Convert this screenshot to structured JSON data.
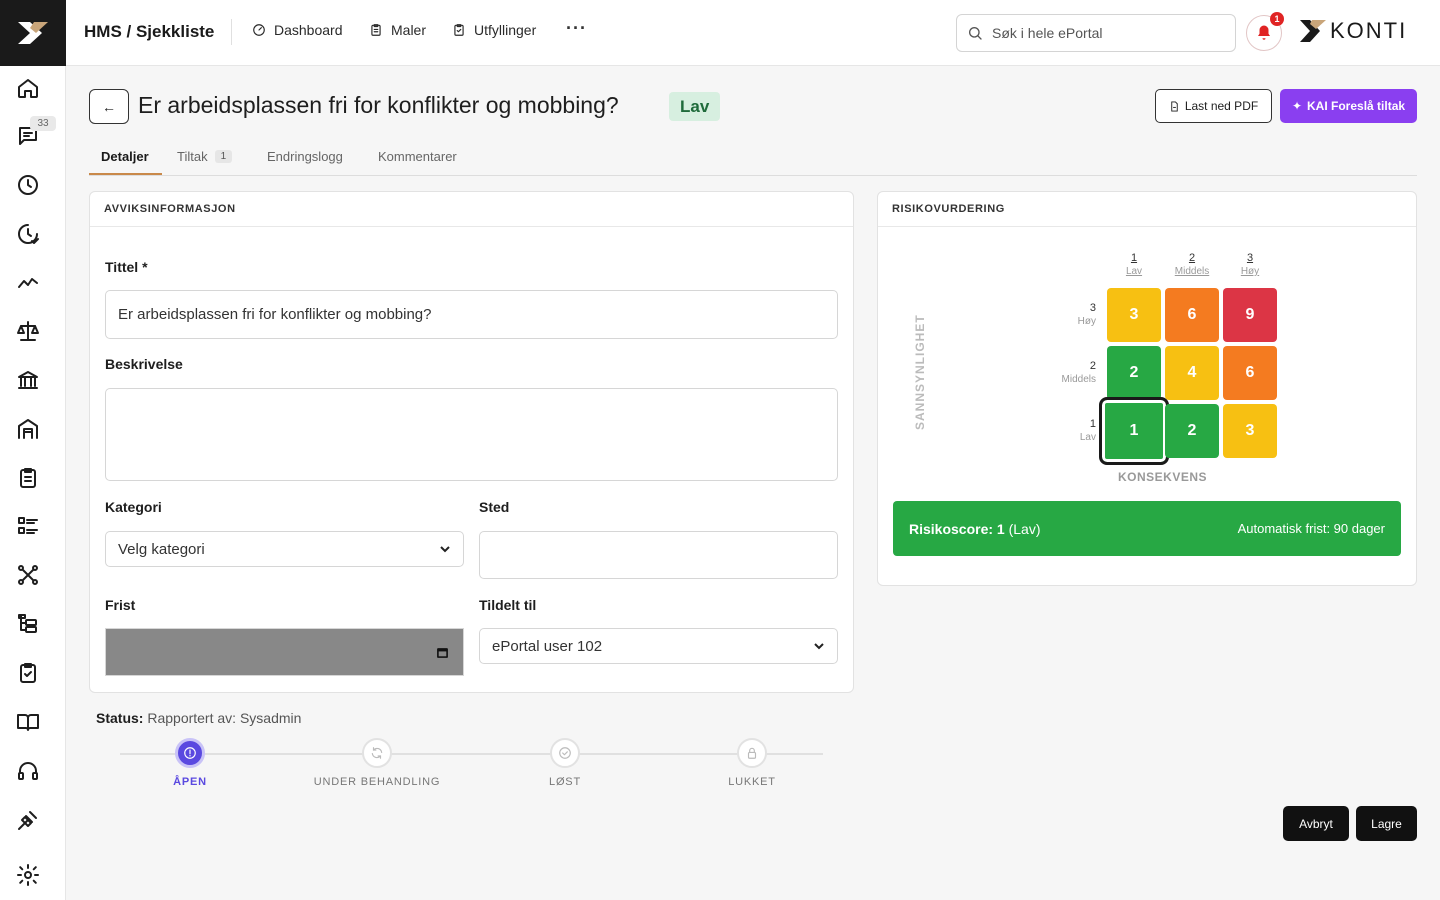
{
  "app": {
    "breadcrumb": "HMS / Sjekkliste",
    "nav": [
      {
        "label": "Dashboard",
        "icon": "dashboard-icon"
      },
      {
        "label": "Maler",
        "icon": "clipboard-icon"
      },
      {
        "label": "Utfyllinger",
        "icon": "clipboard-check-icon"
      }
    ],
    "more": "···",
    "search_placeholder": "Søk i hele ePortal",
    "notification_count": "1",
    "brand_name": "KONTI"
  },
  "sidebar": {
    "messages_badge": "33",
    "icons": [
      "home-icon",
      "messages-icon",
      "clock-icon",
      "clock-check-icon",
      "activity-icon",
      "scale-icon",
      "bank-icon",
      "warehouse-icon",
      "clipboard-list-icon",
      "list-check-icon",
      "network-icon",
      "tree-icon",
      "clipboard-check-icon",
      "book-icon",
      "headset-icon",
      "plug-icon",
      "settings-icon"
    ]
  },
  "header": {
    "back_label": "←",
    "title": "Er arbeidsplassen fri for konflikter og mobbing?",
    "badge": "Lav",
    "pdf_label": "Last ned PDF",
    "kai_label": "KAI Foreslå tiltak"
  },
  "tabs": [
    {
      "label": "Detaljer",
      "active": true
    },
    {
      "label": "Tiltak",
      "count": "1"
    },
    {
      "label": "Endringslogg"
    },
    {
      "label": "Kommentarer"
    }
  ],
  "avvik": {
    "section_title": "AVVIKSINFORMASJON",
    "title_label": "Tittel *",
    "title_value": "Er arbeidsplassen fri for konflikter og mobbing?",
    "description_label": "Beskrivelse",
    "description_value": "",
    "category_label": "Kategori",
    "category_value": "Velg kategori",
    "location_label": "Sted",
    "location_value": "",
    "deadline_label": "Frist",
    "assigned_label": "Tildelt til",
    "assigned_value": "ePortal user 102"
  },
  "risk": {
    "section_title": "RISIKOVURDERING",
    "columns": [
      {
        "num": "1",
        "name": "Lav"
      },
      {
        "num": "2",
        "name": "Middels"
      },
      {
        "num": "3",
        "name": "Høy"
      }
    ],
    "rows": [
      {
        "num": "3",
        "name": "Høy",
        "cells": [
          "3",
          "6",
          "9"
        ]
      },
      {
        "num": "2",
        "name": "Middels",
        "cells": [
          "2",
          "4",
          "6"
        ]
      },
      {
        "num": "1",
        "name": "Lav",
        "cells": [
          "1",
          "2",
          "3"
        ]
      }
    ],
    "colors": {
      "green": "#27a844",
      "yellow": "#f7c012",
      "orange": "#f47b20",
      "red": "#dc3545"
    },
    "y_axis": "SANNSYNLIGHET",
    "x_axis": "KONSEKVENS",
    "score_label": "Risikoscore: 1",
    "score_level": "(Lav)",
    "deadline_text": "Automatisk frist: 90 dager"
  },
  "status": {
    "label": "Status:",
    "reported_by": "Rapportert av: Sysadmin",
    "steps": [
      {
        "label": "ÅPEN",
        "active": true
      },
      {
        "label": "UNDER BEHANDLING"
      },
      {
        "label": "LØST"
      },
      {
        "label": "LUKKET"
      }
    ]
  },
  "actions": {
    "cancel": "Avbryt",
    "save": "Lagre"
  }
}
